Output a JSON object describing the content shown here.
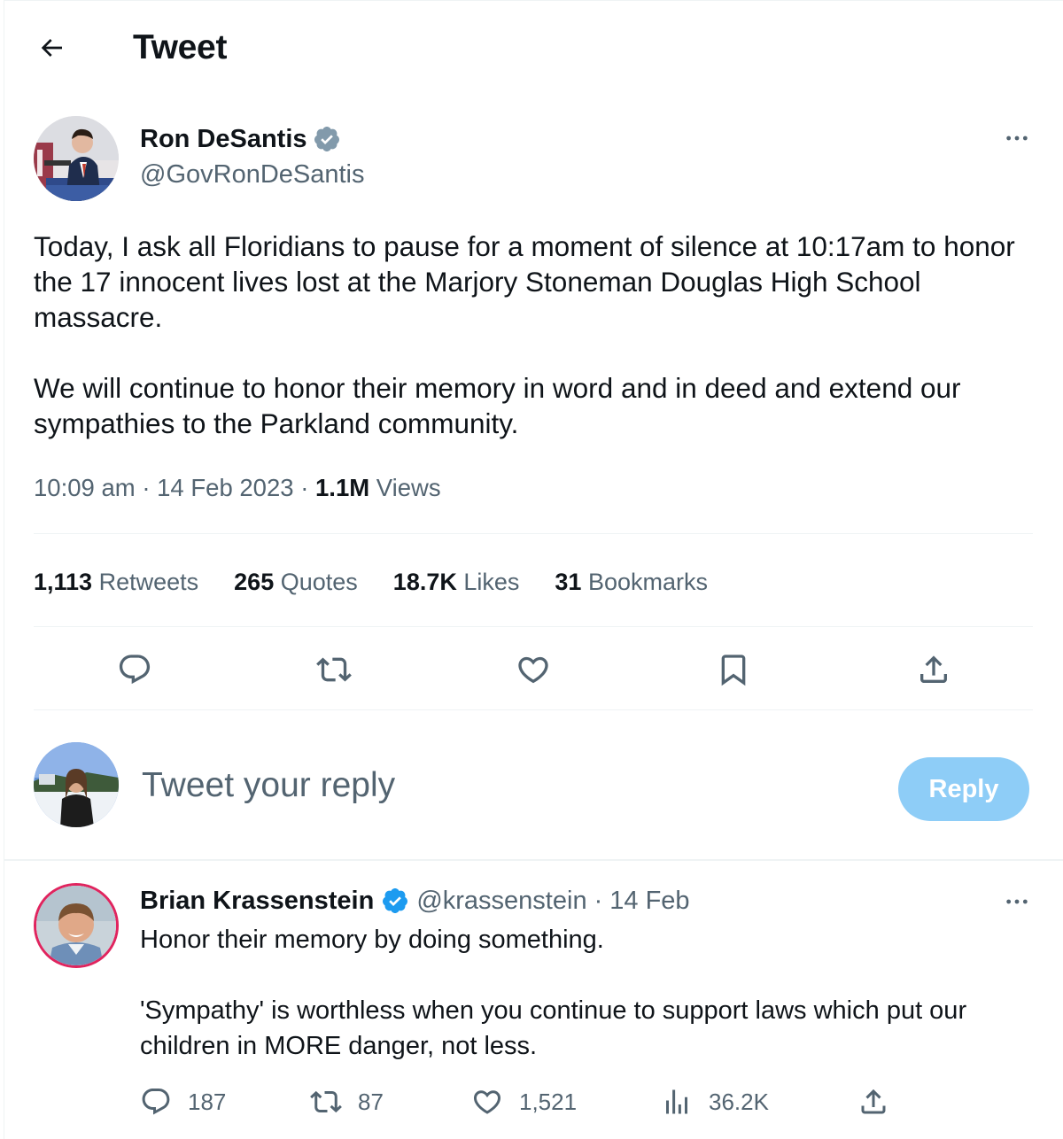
{
  "header": {
    "title": "Tweet"
  },
  "tweet": {
    "author_name": "Ron DeSantis",
    "author_handle": "@GovRonDeSantis",
    "text": [
      "Today, I ask all Floridians to pause for a moment of silence at 10:17am to honor the 17 innocent lives lost at the Marjory Stoneman Douglas High School massacre.",
      "We will continue to honor their memory in word and in deed and extend our sympathies to the Parkland community."
    ],
    "time": "10:09 am",
    "sep1": "·",
    "date": "14 Feb 2023",
    "sep2": "·",
    "views_count": "1.1M",
    "views_label": "Views",
    "stats": [
      {
        "count": "1,113",
        "label": "Retweets"
      },
      {
        "count": "265",
        "label": "Quotes"
      },
      {
        "count": "18.7K",
        "label": "Likes"
      },
      {
        "count": "31",
        "label": "Bookmarks"
      }
    ]
  },
  "composer": {
    "placeholder": "Tweet your reply",
    "button_label": "Reply"
  },
  "reply": {
    "author_name": "Brian Krassenstein",
    "author_handle": "@krassenstein",
    "dot": "·",
    "date": "14 Feb",
    "text": [
      "Honor their memory by doing something.",
      "'Sympathy' is worthless when you continue to support laws which put our children in MORE danger, not less."
    ],
    "replies": "187",
    "retweets": "87",
    "likes": "1,521",
    "views": "36.2K"
  },
  "colors": {
    "primary_text": "#0f1419",
    "secondary_text": "#536471",
    "verified": "#1d9bf0",
    "reply_button": "#8ecdf7",
    "divider": "#eff3f4"
  }
}
